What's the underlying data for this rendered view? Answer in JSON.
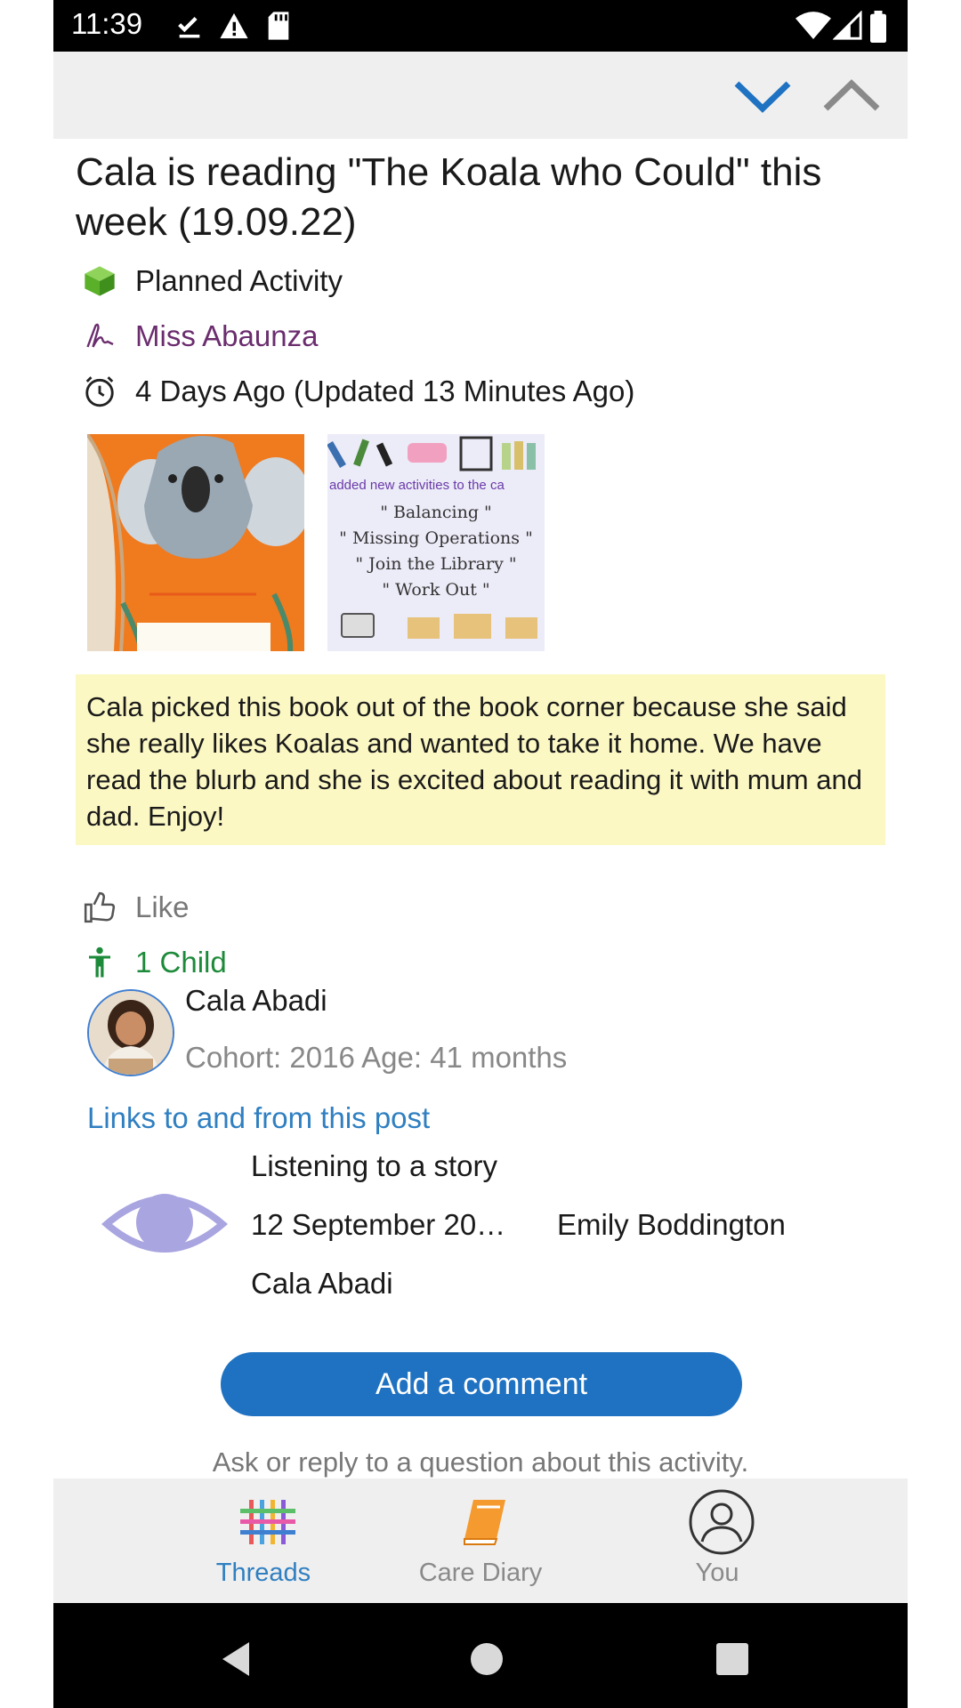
{
  "status_bar": {
    "time": "11:39"
  },
  "post": {
    "title": "Cala is reading \"The Koala who Could\" this week (19.09.22)",
    "type": "Planned Activity",
    "author": "Miss Abaunza",
    "time": "4 Days Ago (Updated 13 Minutes Ago)",
    "images": [
      {
        "name": "koala-book-cover"
      },
      {
        "name": "activities-poster",
        "lines": [
          "added new activities to the ca",
          "\" Balancing \"",
          "\" Missing Operations \"",
          "\" Join the Library \"",
          "\" Work Out \""
        ]
      }
    ],
    "note": "Cala picked this book out of the book corner because she said she really likes Koalas and wanted to take it home. We have read the blurb and she is excited about reading it with mum and dad. Enjoy!",
    "like_label": "Like",
    "children_count_label": "1 Child",
    "child": {
      "name": "Cala Abadi",
      "info": "Cohort: 2016 Age: 41 months"
    },
    "links_title": "Links to and from this post",
    "link": {
      "title": "Listening to a story",
      "date": "12 September 20…",
      "author": "Emily Boddington",
      "child": "Cala Abadi"
    },
    "comment_button": "Add a comment",
    "comment_helper": "Ask or reply to a question about this activity."
  },
  "bottom_nav": {
    "tabs": [
      {
        "label": "Threads",
        "icon": "threads-icon",
        "active": true
      },
      {
        "label": "Care Diary",
        "icon": "book-icon",
        "active": false
      },
      {
        "label": "You",
        "icon": "user-icon",
        "active": false
      }
    ]
  },
  "colors": {
    "accent": "#2f7fc1",
    "button": "#1f72c2",
    "author": "#6b2d6e",
    "child": "#1d8a3a",
    "note_bg": "#fcf8c4"
  }
}
